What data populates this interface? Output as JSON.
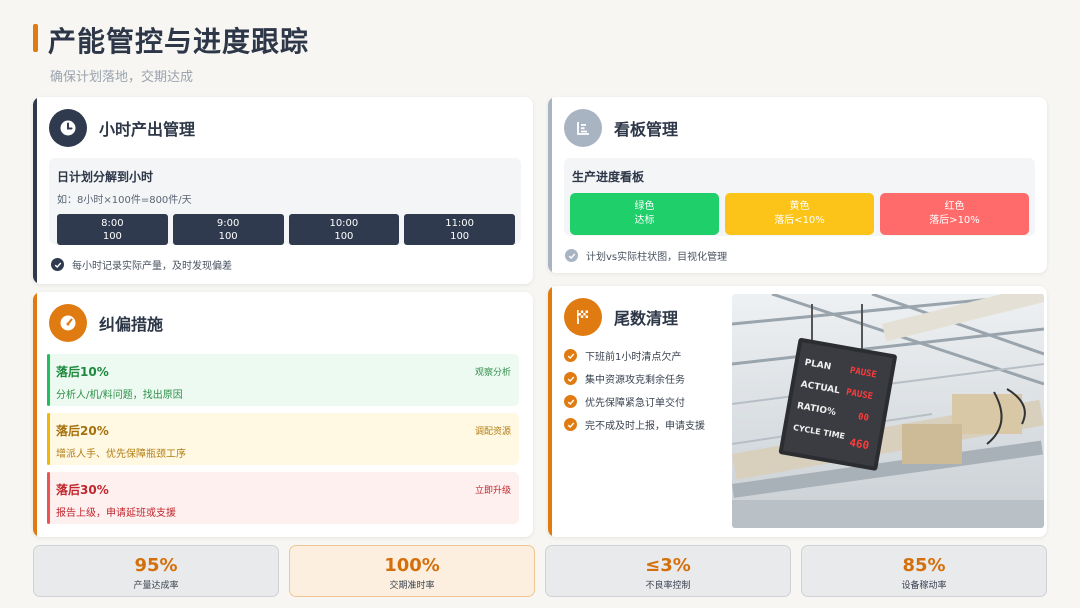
{
  "header": {
    "title": "产能管控与进度跟踪",
    "subtitle": "确保计划落地，交期达成"
  },
  "hourly": {
    "title": "小时产出管理",
    "box_title": "日计划分解到小时",
    "box_sub": "如：8小时×100件=800件/天",
    "slots": [
      {
        "time": "8:00",
        "qty": "100"
      },
      {
        "time": "9:00",
        "qty": "100"
      },
      {
        "time": "10:00",
        "qty": "100"
      },
      {
        "time": "11:00",
        "qty": "100"
      }
    ],
    "note": "每小时记录实际产量，及时发现偏差"
  },
  "kanban": {
    "title": "看板管理",
    "box_title": "生产进度看板",
    "lights": [
      {
        "name": "绿色",
        "desc": "达标",
        "color": "#1fcf6a"
      },
      {
        "name": "黄色",
        "desc": "落后<10%",
        "color": "#fcc419"
      },
      {
        "name": "红色",
        "desc": "落后>10%",
        "color": "#ff6b6b"
      }
    ],
    "note": "计划vs实际柱状图，目视化管理"
  },
  "correction": {
    "title": "纠偏措施",
    "items": [
      {
        "title": "落后10%",
        "desc": "分析人/机/料问题，找出原因",
        "tag": "观察分析"
      },
      {
        "title": "落后20%",
        "desc": "增派人手、优先保障瓶颈工序",
        "tag": "调配资源"
      },
      {
        "title": "落后30%",
        "desc": "报告上级，申请延班或支援",
        "tag": "立即升级"
      }
    ]
  },
  "tail": {
    "title": "尾数清理",
    "items": [
      "下班前1小时清点欠产",
      "集中资源攻克剩余任务",
      "优先保障紧急订单交付",
      "完不成及时上报，申请支援"
    ],
    "board_lines": [
      "PLAN",
      "ACTUAL",
      "RATIO%",
      "CYCLE TIME"
    ],
    "board_values": [
      "PAUSE",
      "PAUSE",
      "00",
      "460"
    ]
  },
  "kpis": [
    {
      "value": "95%",
      "label": "产量达成率"
    },
    {
      "value": "100%",
      "label": "交期准时率"
    },
    {
      "value": "≤3%",
      "label": "不良率控制"
    },
    {
      "value": "85%",
      "label": "设备稼动率"
    }
  ],
  "colors": {
    "accent": "#e07b12",
    "navy": "#2f3a4e",
    "gray_icon": "#a9b4c2"
  }
}
